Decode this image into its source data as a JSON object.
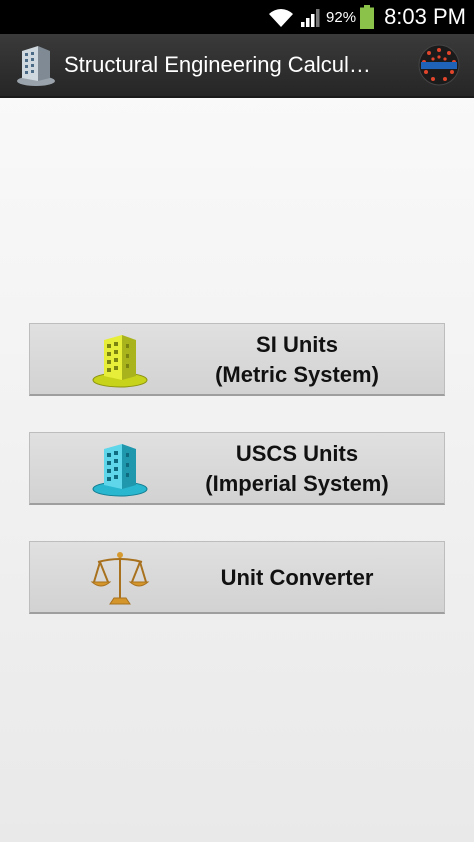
{
  "status_bar": {
    "battery_percent": "92%",
    "time": "8:03 PM",
    "icons": [
      "wifi-icon",
      "signal-icon",
      "battery-icon"
    ]
  },
  "action_bar": {
    "title": "Structural Engineering Calcul…",
    "app_icon": "building-icon",
    "logo": "sparkle-logo"
  },
  "buttons": [
    {
      "line1": "SI Units",
      "line2": "(Metric System)",
      "icon": "yellow-building-icon"
    },
    {
      "line1": "USCS Units",
      "line2": "(Imperial System)",
      "icon": "blue-building-icon"
    },
    {
      "line1": "Unit Converter",
      "icon": "balance-scale-icon"
    }
  ],
  "colors": {
    "status_bar_bg": "#000000",
    "action_bar_bg": "#2e2e2e",
    "button_bg": "#d9d9d9",
    "battery_green": "#8bc34a"
  }
}
